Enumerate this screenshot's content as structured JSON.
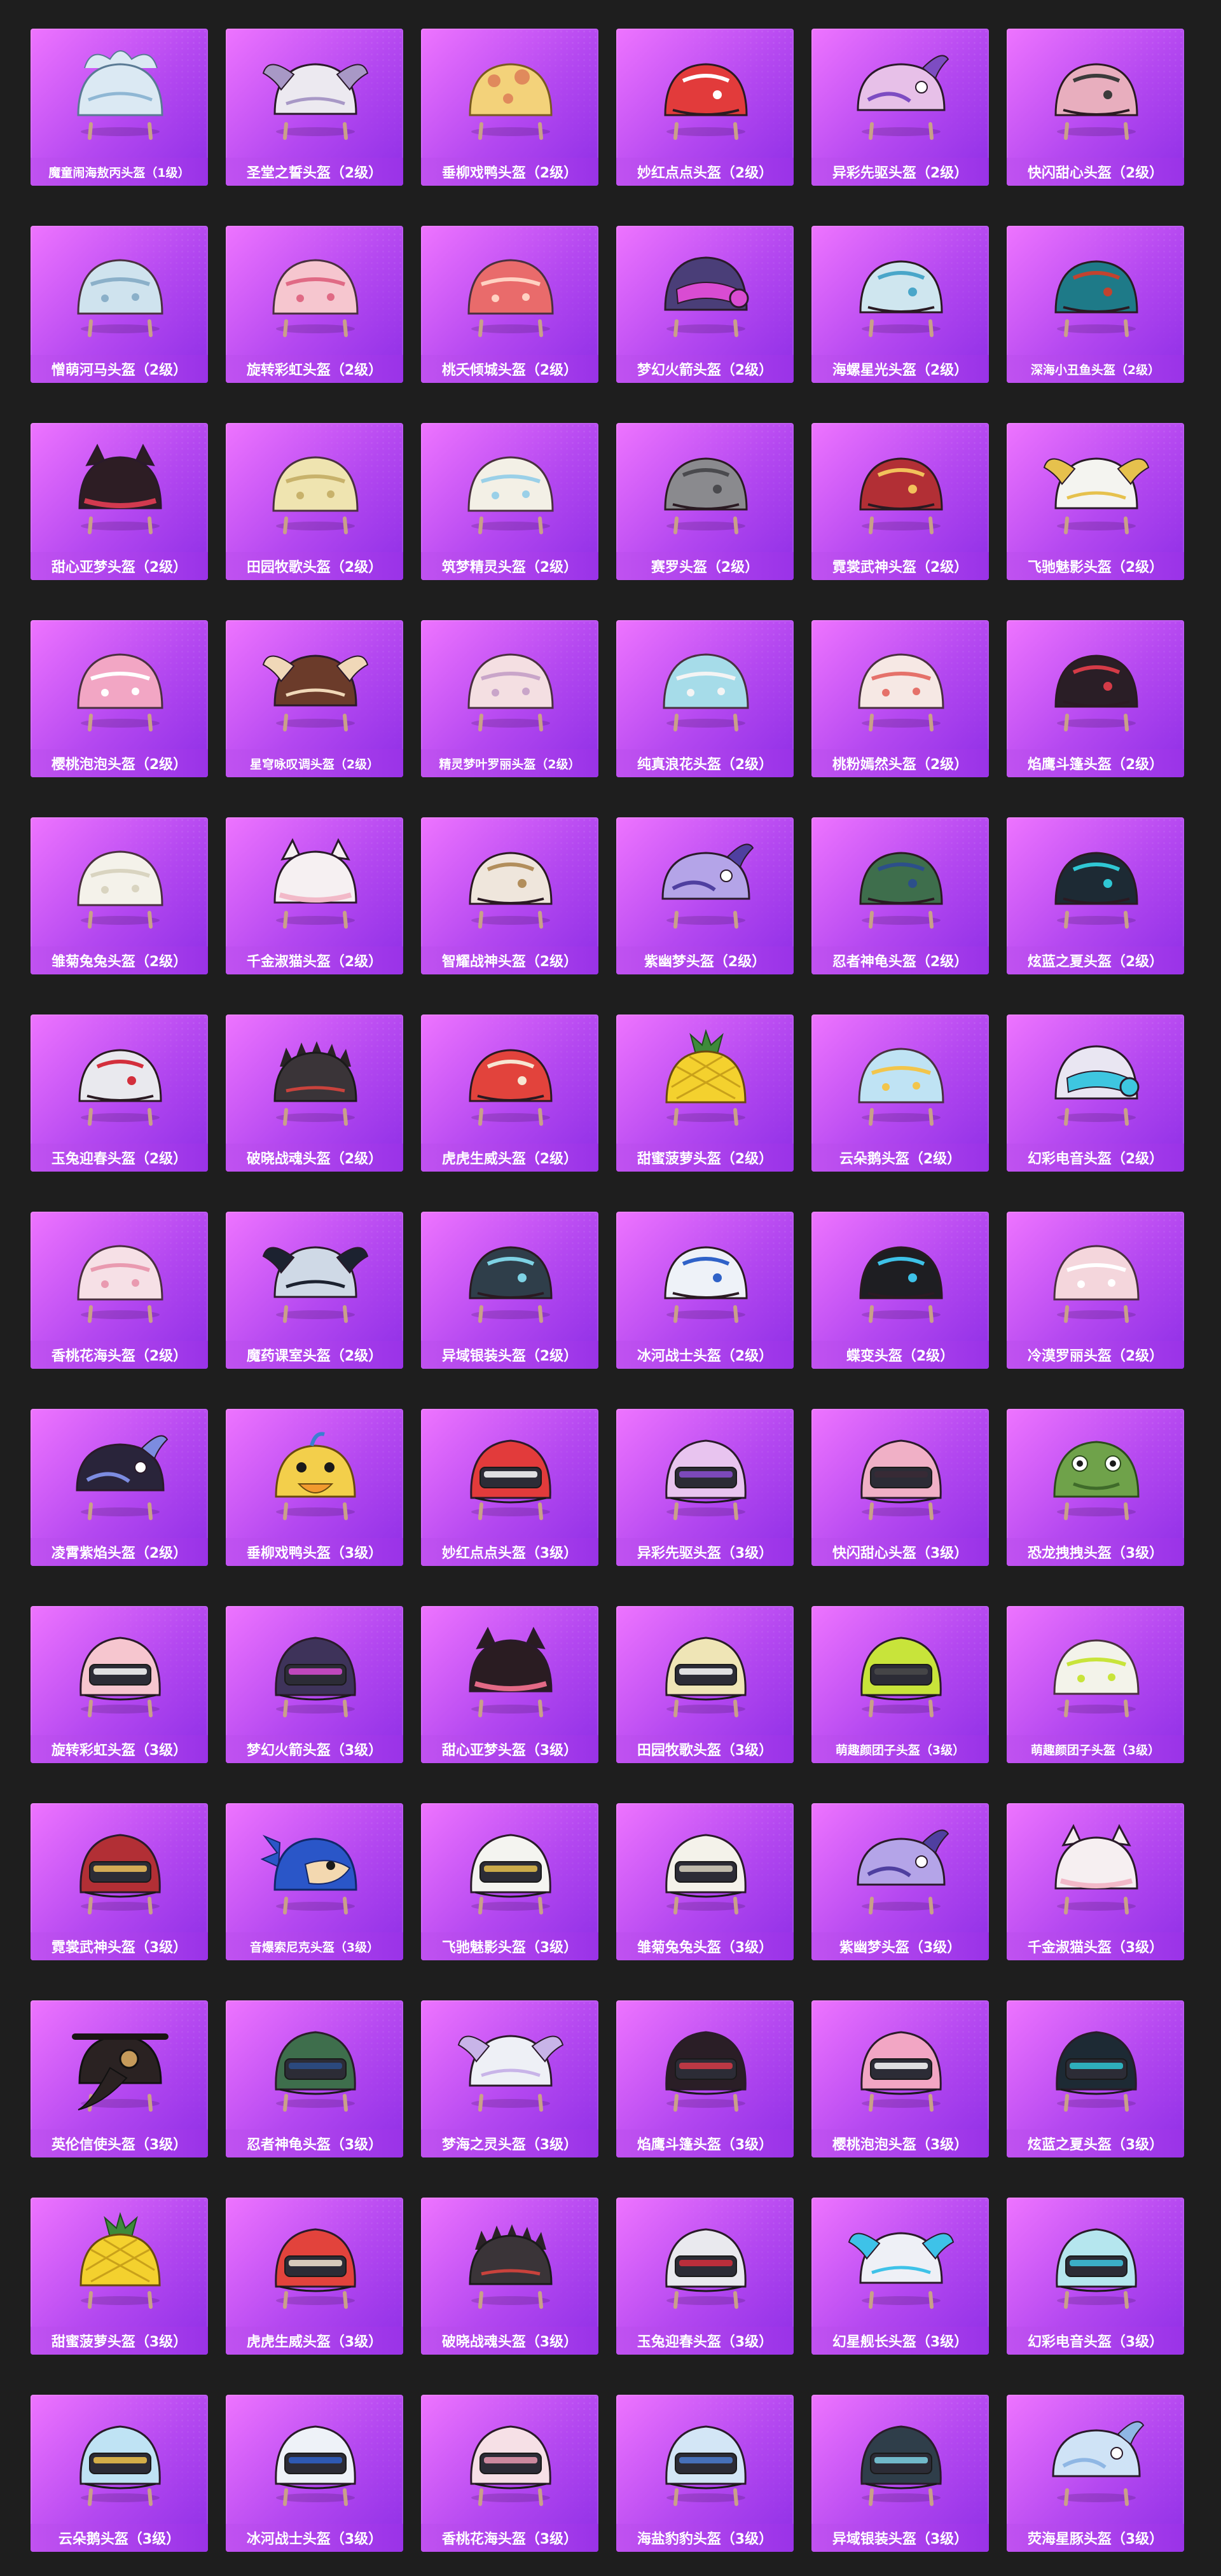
{
  "grid": {
    "items": [
      {
        "name": "魔童闹海敖丙头盔（1级）",
        "shape": "ice-dragon",
        "color": "#dbe9f3",
        "accent": "#8fb7d4"
      },
      {
        "name": "圣堂之誓头盔（2级）",
        "shape": "winged",
        "color": "#ece9f0",
        "accent": "#a898c6"
      },
      {
        "name": "垂柳戏鸭头盔（2级）",
        "shape": "bumpy",
        "color": "#f3d27a",
        "accent": "#e08a5c"
      },
      {
        "name": "妙红点点头盔（2级）",
        "shape": "dome",
        "color": "#e23b3b",
        "accent": "#ffffff"
      },
      {
        "name": "异彩先驱头盔（2级）",
        "shape": "fish",
        "color": "#e7c0e8",
        "accent": "#7d4cc2"
      },
      {
        "name": "快闪甜心头盔（2级）",
        "shape": "dome",
        "color": "#e8aebe",
        "accent": "#3b3b3b"
      },
      {
        "name": "憎萌河马头盔（2级）",
        "shape": "round",
        "color": "#cfe3ee",
        "accent": "#8bb0c9"
      },
      {
        "name": "旋转彩虹头盔（2级）",
        "shape": "round",
        "color": "#f6c6cf",
        "accent": "#e06a85"
      },
      {
        "name": "桃夭倾城头盔（2级）",
        "shape": "round",
        "color": "#e96b6b",
        "accent": "#ffd1c2"
      },
      {
        "name": "梦幻火箭头盔（2级）",
        "shape": "visor",
        "color": "#4a3e78",
        "accent": "#d94cd2"
      },
      {
        "name": "海螺星光头盔（2级）",
        "shape": "dome",
        "color": "#cfe6ef",
        "accent": "#49a6c9"
      },
      {
        "name": "深海小丑鱼头盔（2级）",
        "shape": "dome",
        "color": "#1e7a88",
        "accent": "#c2432f"
      },
      {
        "name": "甜心亚梦头盔（2级）",
        "shape": "cat",
        "color": "#2d1d24",
        "accent": "#d23a4f"
      },
      {
        "name": "田园牧歌头盔（2级）",
        "shape": "round",
        "color": "#efe4b0",
        "accent": "#c8b26b"
      },
      {
        "name": "筑梦精灵头盔（2级）",
        "shape": "round",
        "color": "#f3f0e6",
        "accent": "#9ad0e8"
      },
      {
        "name": "赛罗头盔（2级）",
        "shape": "dome",
        "color": "#8a8a8e",
        "accent": "#4a4a4e"
      },
      {
        "name": "霓裳武神头盔（2级）",
        "shape": "dome",
        "color": "#b22f35",
        "accent": "#f2c25b"
      },
      {
        "name": "飞驰魅影头盔（2级）",
        "shape": "winged",
        "color": "#f4f4f0",
        "accent": "#e6c14d"
      },
      {
        "name": "樱桃泡泡头盔（2级）",
        "shape": "round",
        "color": "#f2a6c4",
        "accent": "#ffffff"
      },
      {
        "name": "星穹咏叹调头盔（2级）",
        "shape": "winged",
        "color": "#6b3b2a",
        "accent": "#f0d8b8"
      },
      {
        "name": "精灵梦叶罗丽头盔（2级）",
        "shape": "round",
        "color": "#f4dfe2",
        "accent": "#c9a5c9"
      },
      {
        "name": "纯真浪花头盔（2级）",
        "shape": "round",
        "color": "#a6dce9",
        "accent": "#f4f4f4"
      },
      {
        "name": "桃粉嫣然头盔（2级）",
        "shape": "round",
        "color": "#f6e8e4",
        "accent": "#e5716a"
      },
      {
        "name": "焰鹰斗篷头盔（2级）",
        "shape": "dome",
        "color": "#2a1e26",
        "accent": "#d43b47"
      },
      {
        "name": "雏菊兔兔头盔（2级）",
        "shape": "round",
        "color": "#f4f2ea",
        "accent": "#d9d4c0"
      },
      {
        "name": "千金淑猫头盔（2级）",
        "shape": "cat",
        "color": "#f6f0f2",
        "accent": "#f2b9c8"
      },
      {
        "name": "智耀战神头盔（2级）",
        "shape": "dome",
        "color": "#efe6dc",
        "accent": "#b28e5c"
      },
      {
        "name": "紫幽梦头盔（2级）",
        "shape": "fish",
        "color": "#b4a4e8",
        "accent": "#4f3fa0"
      },
      {
        "name": "忍者神龟头盔（2级）",
        "shape": "dome",
        "color": "#3e6e4c",
        "accent": "#2c4f8a"
      },
      {
        "name": "炫蓝之夏头盔（2级）",
        "shape": "dome",
        "color": "#1d2a34",
        "accent": "#2fc7d4"
      },
      {
        "name": "玉兔迎春头盔（2级）",
        "shape": "dome",
        "color": "#e9e9ee",
        "accent": "#d32f3c"
      },
      {
        "name": "破晓战魂头盔（2级）",
        "shape": "spiked",
        "color": "#3a3438",
        "accent": "#c9423c"
      },
      {
        "name": "虎虎生威头盔（2级）",
        "shape": "dome",
        "color": "#e2433c",
        "accent": "#f6e6d2"
      },
      {
        "name": "甜蜜菠萝头盔（2级）",
        "shape": "pineapple",
        "color": "#f4d12e",
        "accent": "#3e8a3a"
      },
      {
        "name": "云朵鹅头盔（2级）",
        "shape": "round",
        "color": "#bfe3f4",
        "accent": "#f2c54b"
      },
      {
        "name": "幻彩电音头盔（2级）",
        "shape": "visor",
        "color": "#e9e6f2",
        "accent": "#3ec6e0"
      },
      {
        "name": "香桃花海头盔（2级）",
        "shape": "round",
        "color": "#f6e0e6",
        "accent": "#e99ab0"
      },
      {
        "name": "魔药课室头盔（2级）",
        "shape": "winged",
        "color": "#cfd9e6",
        "accent": "#1c2230"
      },
      {
        "name": "异域银装头盔（2级）",
        "shape": "dome",
        "color": "#2f3e4a",
        "accent": "#7ed2e4"
      },
      {
        "name": "冰河战士头盔（2级）",
        "shape": "dome",
        "color": "#eef2f8",
        "accent": "#2f62c8"
      },
      {
        "name": "蝶变头盔（2级）",
        "shape": "dome",
        "color": "#1e1e22",
        "accent": "#3ec2e8"
      },
      {
        "name": "冷漠罗丽头盔（2级）",
        "shape": "round",
        "color": "#f4d6dc",
        "accent": "#ffffff"
      },
      {
        "name": "凌霄紫焰头盔（2级）",
        "shape": "fish",
        "color": "#29243a",
        "accent": "#7c8ce0"
      },
      {
        "name": "垂柳戏鸭头盔（3级）",
        "shape": "duck",
        "color": "#f3cf4b",
        "accent": "#3a7fd0"
      },
      {
        "name": "妙红点点头盔（3级）",
        "shape": "visor3",
        "color": "#e23b3b",
        "accent": "#ffffff"
      },
      {
        "name": "异彩先驱头盔（3级）",
        "shape": "visor3",
        "color": "#e8c4ef",
        "accent": "#8b4fd1"
      },
      {
        "name": "快闪甜心头盔（3级）",
        "shape": "visor3",
        "color": "#f0b0c6",
        "accent": "#3a2a35"
      },
      {
        "name": "恐龙拽拽头盔（3级）",
        "shape": "dino",
        "color": "#6fa24a",
        "accent": "#3f6b2a"
      },
      {
        "name": "旋转彩虹头盔（3级）",
        "shape": "visor3",
        "color": "#f6c6cf",
        "accent": "#ffffff"
      },
      {
        "name": "梦幻火箭头盔（3级）",
        "shape": "visor3",
        "color": "#3e335a",
        "accent": "#d94cd2"
      },
      {
        "name": "甜心亚梦头盔（3级）",
        "shape": "cat3",
        "color": "#2a1c22",
        "accent": "#e36a86"
      },
      {
        "name": "田园牧歌头盔（3级）",
        "shape": "visor3",
        "color": "#efe5b6",
        "accent": "#ffffff"
      },
      {
        "name": "萌趣颜团子头盔（3级）",
        "shape": "visor3",
        "color": "#c8e43a",
        "accent": "#4a4a4a"
      },
      {
        "name": "萌趣颜团子头盔（3级）",
        "shape": "round",
        "color": "#f3f3ea",
        "accent": "#c8e43a"
      },
      {
        "name": "霓裳武神头盔（3级）",
        "shape": "visor3",
        "color": "#b22f35",
        "accent": "#f2c25b"
      },
      {
        "name": "音爆索尼克头盔（3级）",
        "shape": "sonic",
        "color": "#2a56c8",
        "accent": "#f3d8b0"
      },
      {
        "name": "飞驰魅影头盔（3级）",
        "shape": "visor3",
        "color": "#f4f4f0",
        "accent": "#e6c14d"
      },
      {
        "name": "雏菊兔兔头盔（3级）",
        "shape": "visor3",
        "color": "#f4f2ea",
        "accent": "#d9d4c0"
      },
      {
        "name": "紫幽梦头盔（3级）",
        "shape": "fish",
        "color": "#b4a4e8",
        "accent": "#4f3fa0"
      },
      {
        "name": "千金淑猫头盔（3级）",
        "shape": "cat3",
        "color": "#f6eff1",
        "accent": "#f2b9c8"
      },
      {
        "name": "英伦信使头盔（3级）",
        "shape": "bird",
        "color": "#2a2222",
        "accent": "#c59a5a"
      },
      {
        "name": "忍者神龟头盔（3级）",
        "shape": "visor3",
        "color": "#3e6e4c",
        "accent": "#2c4f8a"
      },
      {
        "name": "梦海之灵头盔（3级）",
        "shape": "winged",
        "color": "#eef0f6",
        "accent": "#c8b4e8"
      },
      {
        "name": "焰鹰斗篷头盔（3级）",
        "shape": "visor3",
        "color": "#2a1e26",
        "accent": "#d43b47"
      },
      {
        "name": "樱桃泡泡头盔（3级）",
        "shape": "visor3",
        "color": "#f2a6c4",
        "accent": "#ffffff"
      },
      {
        "name": "炫蓝之夏头盔（3级）",
        "shape": "visor3",
        "color": "#1d2a34",
        "accent": "#2fc7d4"
      },
      {
        "name": "甜蜜菠萝头盔（3级）",
        "shape": "pineapple",
        "color": "#f4d12e",
        "accent": "#3e8a3a"
      },
      {
        "name": "虎虎生威头盔（3级）",
        "shape": "visor3",
        "color": "#e2433c",
        "accent": "#f6e6d2"
      },
      {
        "name": "破晓战魂头盔（3级）",
        "shape": "spiked",
        "color": "#3a3438",
        "accent": "#c9423c"
      },
      {
        "name": "玉兔迎春头盔（3级）",
        "shape": "visor3",
        "color": "#e9e9ee",
        "accent": "#d32f3c"
      },
      {
        "name": "幻星舰长头盔（3级）",
        "shape": "winged",
        "color": "#eef0f6",
        "accent": "#3ec2e8"
      },
      {
        "name": "幻彩电音头盔（3级）",
        "shape": "visor3",
        "color": "#b5e6ee",
        "accent": "#3ec6e0"
      },
      {
        "name": "云朵鹅头盔（3级）",
        "shape": "visor3",
        "color": "#bfe3f4",
        "accent": "#f2c54b"
      },
      {
        "name": "冰河战士头盔（3级）",
        "shape": "visor3",
        "color": "#eef2f8",
        "accent": "#2f62c8"
      },
      {
        "name": "香桃花海头盔（3级）",
        "shape": "visor3",
        "color": "#f6e0e6",
        "accent": "#e99ab0"
      },
      {
        "name": "海盐豹豹头盔（3级）",
        "shape": "visor3",
        "color": "#d3e6f6",
        "accent": "#4b7dd0"
      },
      {
        "name": "异域银装头盔（3级）",
        "shape": "visor3",
        "color": "#2f3e4a",
        "accent": "#7ed2e4"
      },
      {
        "name": "荧海星豚头盔（3级）",
        "shape": "fish",
        "color": "#cfe3f6",
        "accent": "#8fb7e4"
      }
    ]
  }
}
